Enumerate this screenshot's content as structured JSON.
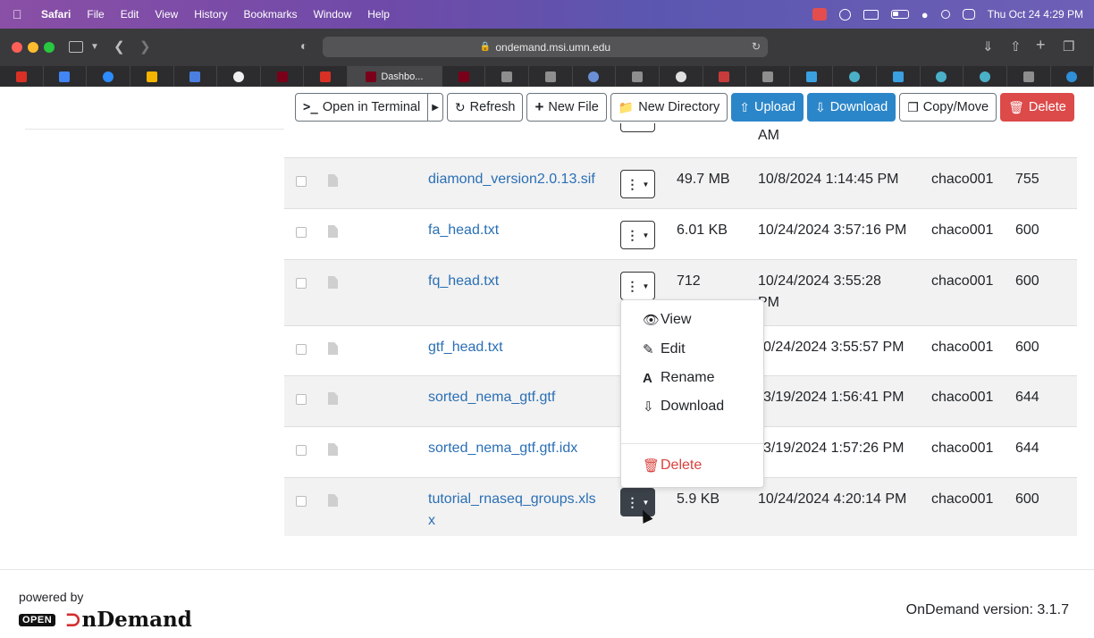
{
  "menubar": {
    "app": "Safari",
    "items": [
      "File",
      "Edit",
      "View",
      "History",
      "Bookmarks",
      "Window",
      "Help"
    ],
    "clock": "Thu Oct 24  4:29 PM"
  },
  "browser": {
    "url": "ondemand.msi.umn.edu",
    "active_tab": "Dashbo..."
  },
  "actions": {
    "terminal": "Open in Terminal",
    "refresh": "Refresh",
    "new_file": "New File",
    "new_directory": "New Directory",
    "upload": "Upload",
    "download": "Download",
    "copy_move": "Copy/Move",
    "delete": "Delete"
  },
  "partial_row": {
    "date_tail": "AM"
  },
  "files": [
    {
      "name": "diamond_version2.0.13.sif",
      "size": "49.7 MB",
      "date": "10/8/2024 1:14:45 PM",
      "owner": "chaco001",
      "mode": "755"
    },
    {
      "name": "fa_head.txt",
      "size": "6.01 KB",
      "date": "10/24/2024 3:57:16 PM",
      "owner": "chaco001",
      "mode": "600"
    },
    {
      "name": "fq_head.txt",
      "size": "712",
      "date": "10/24/2024 3:55:28",
      "date2": "PM",
      "owner": "chaco001",
      "mode": "600"
    },
    {
      "name": "gtf_head.txt",
      "size": "",
      "date": "0/24/2024 3:55:57 PM",
      "owner": "chaco001",
      "mode": "600"
    },
    {
      "name": "sorted_nema_gtf.gtf",
      "size": "",
      "date": "3/19/2024 1:56:41 PM",
      "owner": "chaco001",
      "mode": "644"
    },
    {
      "name": "sorted_nema_gtf.gtf.idx",
      "size": "",
      "date": "3/19/2024 1:57:26 PM",
      "owner": "chaco001",
      "mode": "644"
    },
    {
      "name": "tutorial_rnaseq_groups.xls",
      "name2": "x",
      "size": "5.9 KB",
      "date": "10/24/2024 4:20:14 PM",
      "owner": "chaco001",
      "mode": "600"
    }
  ],
  "dropdown": {
    "view": "View",
    "edit": "Edit",
    "rename": "Rename",
    "download": "Download",
    "delete": "Delete"
  },
  "footer": {
    "powered_by": "powered by",
    "logo_open": "OPEN",
    "logo_name_rest": "nDemand",
    "version": "OnDemand version: 3.1.7"
  },
  "colors": {
    "primary": "#2b86c9",
    "danger": "#dc4a4a",
    "link": "#2a6fb5"
  }
}
